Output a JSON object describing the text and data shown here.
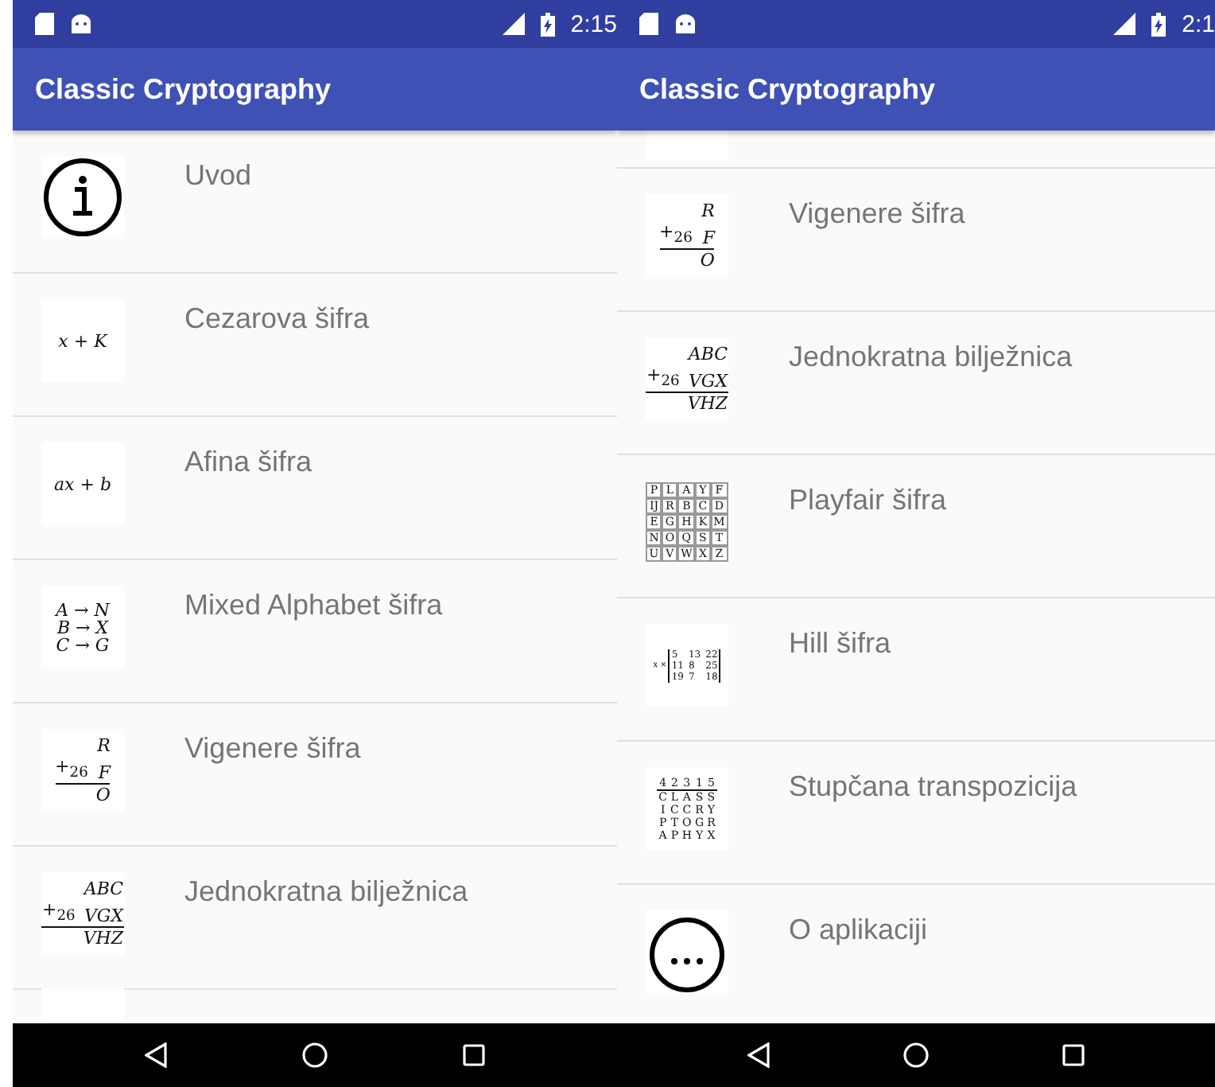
{
  "screens": [
    {
      "status_bar": {
        "time": "2:15"
      },
      "app_bar": {
        "title": "Classic Cryptography"
      },
      "items": [
        {
          "kind": "info",
          "label": "Uvod"
        },
        {
          "kind": "lines",
          "label": "Cezarova šifra",
          "lines": [
            "x + K"
          ]
        },
        {
          "kind": "lines",
          "label": "Afina šifra",
          "lines": [
            "ax + b"
          ]
        },
        {
          "kind": "lines",
          "label": "Mixed Alphabet šifra",
          "lines": [
            "A → N",
            "B → X",
            "C → G"
          ]
        },
        {
          "kind": "sum",
          "label": "Vigenere šifra",
          "operator": "+",
          "modulus": "26",
          "top": "R",
          "addend": "F",
          "result": "O"
        },
        {
          "kind": "sum",
          "label": "Jednokratna bilježnica",
          "operator": "+",
          "modulus": "26",
          "top": "ABC",
          "addend": "VGX",
          "result": "VHZ"
        },
        {
          "kind": "cut"
        }
      ]
    },
    {
      "status_bar": {
        "time": "2:1"
      },
      "app_bar": {
        "title": "Classic Cryptography"
      },
      "items": [
        {
          "kind": "cut"
        },
        {
          "kind": "sum",
          "label": "Vigenere šifra",
          "operator": "+",
          "modulus": "26",
          "top": "R",
          "addend": "F",
          "result": "O"
        },
        {
          "kind": "sum",
          "label": "Jednokratna bilježnica",
          "operator": "+",
          "modulus": "26",
          "top": "ABC",
          "addend": "VGX",
          "result": "VHZ"
        },
        {
          "kind": "grid",
          "label": "Playfair šifra",
          "rows": [
            [
              "P",
              "L",
              "A",
              "Y",
              "F"
            ],
            [
              "IJ",
              "R",
              "B",
              "C",
              "D"
            ],
            [
              "E",
              "G",
              "H",
              "K",
              "M"
            ],
            [
              "N",
              "O",
              "Q",
              "S",
              "T"
            ],
            [
              "U",
              "V",
              "W",
              "X",
              "Z"
            ]
          ]
        },
        {
          "kind": "matrix",
          "label": "Hill šifra",
          "prefix": "x ×",
          "rows": [
            [
              "5",
              "13",
              "22"
            ],
            [
              "11",
              "8",
              "25"
            ],
            [
              "19",
              "7",
              "18"
            ]
          ]
        },
        {
          "kind": "columnar",
          "label": "Stupčana transpozicija",
          "header": [
            "4",
            "2",
            "3",
            "1",
            "5"
          ],
          "rows": [
            [
              "C",
              "L",
              "A",
              "S",
              "S"
            ],
            [
              "I",
              "C",
              "C",
              "R",
              "Y"
            ],
            [
              "P",
              "T",
              "O",
              "G",
              "R"
            ],
            [
              "A",
              "P",
              "H",
              "Y",
              "X"
            ]
          ]
        },
        {
          "kind": "more",
          "label": "O aplikaciji"
        }
      ]
    }
  ]
}
